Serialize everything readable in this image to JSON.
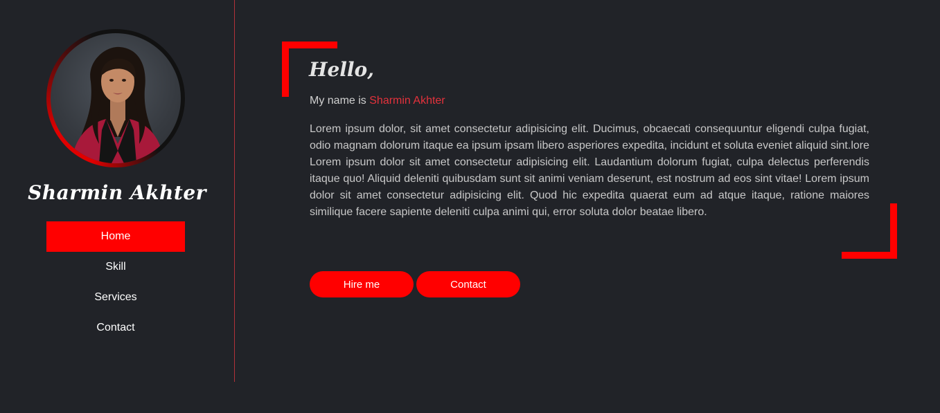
{
  "sidebar": {
    "avatar_alt": "Sharmin Akhter portrait",
    "name": "Sharmin Akhter",
    "nav": [
      {
        "label": "Home",
        "active": true
      },
      {
        "label": "Skill",
        "active": false
      },
      {
        "label": "Services",
        "active": false
      },
      {
        "label": "Contact",
        "active": false
      }
    ]
  },
  "main": {
    "greeting": "Hello,",
    "intro_prefix": "My name is ",
    "intro_name": "Sharmin Akhter",
    "bio": "Lorem ipsum dolor, sit amet consectetur adipisicing elit. Ducimus, obcaecati consequuntur eligendi culpa fugiat, odio magnam dolorum itaque ea ipsum ipsam libero asperiores expedita, incidunt et soluta eveniet aliquid sint.lore Lorem ipsum dolor sit amet consectetur adipisicing elit. Laudantium dolorum fugiat, culpa delectus perferendis itaque quo! Aliquid deleniti quibusdam sunt sit animi veniam deserunt, est nostrum ad eos sint vitae! Lorem ipsum dolor sit amet consectetur adipisicing elit. Quod hic expedita quaerat eum ad atque itaque, ratione maiores similique facere sapiente deleniti culpa animi qui, error soluta dolor beatae libero.",
    "buttons": {
      "hire_label": "Hire me",
      "contact_label": "Contact"
    }
  },
  "colors": {
    "background": "#212328",
    "accent": "#ff0000",
    "highlight_text": "#e5323c",
    "divider": "#b3313a"
  }
}
